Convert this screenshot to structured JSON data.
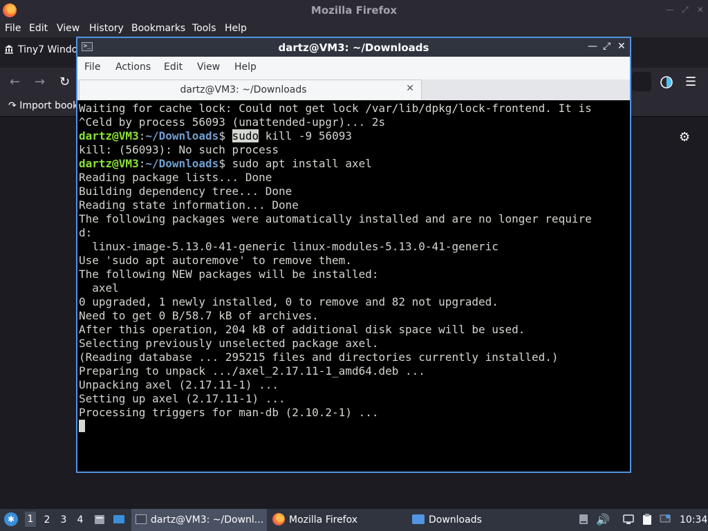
{
  "firefox": {
    "window_title": "Mozilla Firefox",
    "menu": [
      "File",
      "Edit",
      "View",
      "History",
      "Bookmarks",
      "Tools",
      "Help"
    ],
    "tab_title": "Tiny7 Windo",
    "bookmark_import": "Import book",
    "icons": [
      "firefox-logo",
      "back-arrow",
      "forward-arrow",
      "reload",
      "import-bookmarks",
      "account-circle",
      "hamburger-menu",
      "settings-gear"
    ]
  },
  "terminal": {
    "window_title": "dartz@VM3: ~/Downloads",
    "menu": [
      "File",
      "Actions",
      "Edit",
      "View",
      "Help"
    ],
    "tab_label": "dartz@VM3: ~/Downloads",
    "prompt": {
      "user": "dartz@VM3",
      "colon": ":",
      "path": "~/Downloads",
      "dollar": "$"
    },
    "lines": [
      "Waiting for cache lock: Could not get lock /var/lib/dpkg/lock-frontend. It is",
      "^Celd by process 56093 (unattended-upgr)... 2s"
    ],
    "cmd1_word": "sudo",
    "cmd1_rest": " kill -9 56093",
    "out1": "kill: (56093): No such process",
    "cmd2": " sudo apt install axel",
    "output": [
      "Reading package lists... Done",
      "Building dependency tree... Done",
      "Reading state information... Done",
      "The following packages were automatically installed and are no longer require",
      "d:",
      "  linux-image-5.13.0-41-generic linux-modules-5.13.0-41-generic",
      "Use 'sudo apt autoremove' to remove them.",
      "The following NEW packages will be installed:",
      "  axel",
      "0 upgraded, 1 newly installed, 0 to remove and 82 not upgraded.",
      "Need to get 0 B/58.7 kB of archives.",
      "After this operation, 204 kB of additional disk space will be used.",
      "Selecting previously unselected package axel.",
      "(Reading database ... 295215 files and directories currently installed.)",
      "Preparing to unpack .../axel_2.17.11-1_amd64.deb ...",
      "Unpacking axel (2.17.11-1) ...",
      "Setting up axel (2.17.11-1) ...",
      "Processing triggers for man-db (2.10.2-1) ..."
    ]
  },
  "taskbar": {
    "workspaces": [
      "1",
      "2",
      "3",
      "4"
    ],
    "tasks": [
      {
        "label": "dartz@VM3: ~/Downl..."
      },
      {
        "label": "Mozilla Firefox"
      },
      {
        "label": "Downloads"
      }
    ],
    "clock": "10:34",
    "icons": [
      "start-menu",
      "file-manager",
      "show-desktop",
      "terminal",
      "firefox",
      "folder",
      "disk",
      "volume",
      "network",
      "clipboard",
      "notifications"
    ]
  }
}
